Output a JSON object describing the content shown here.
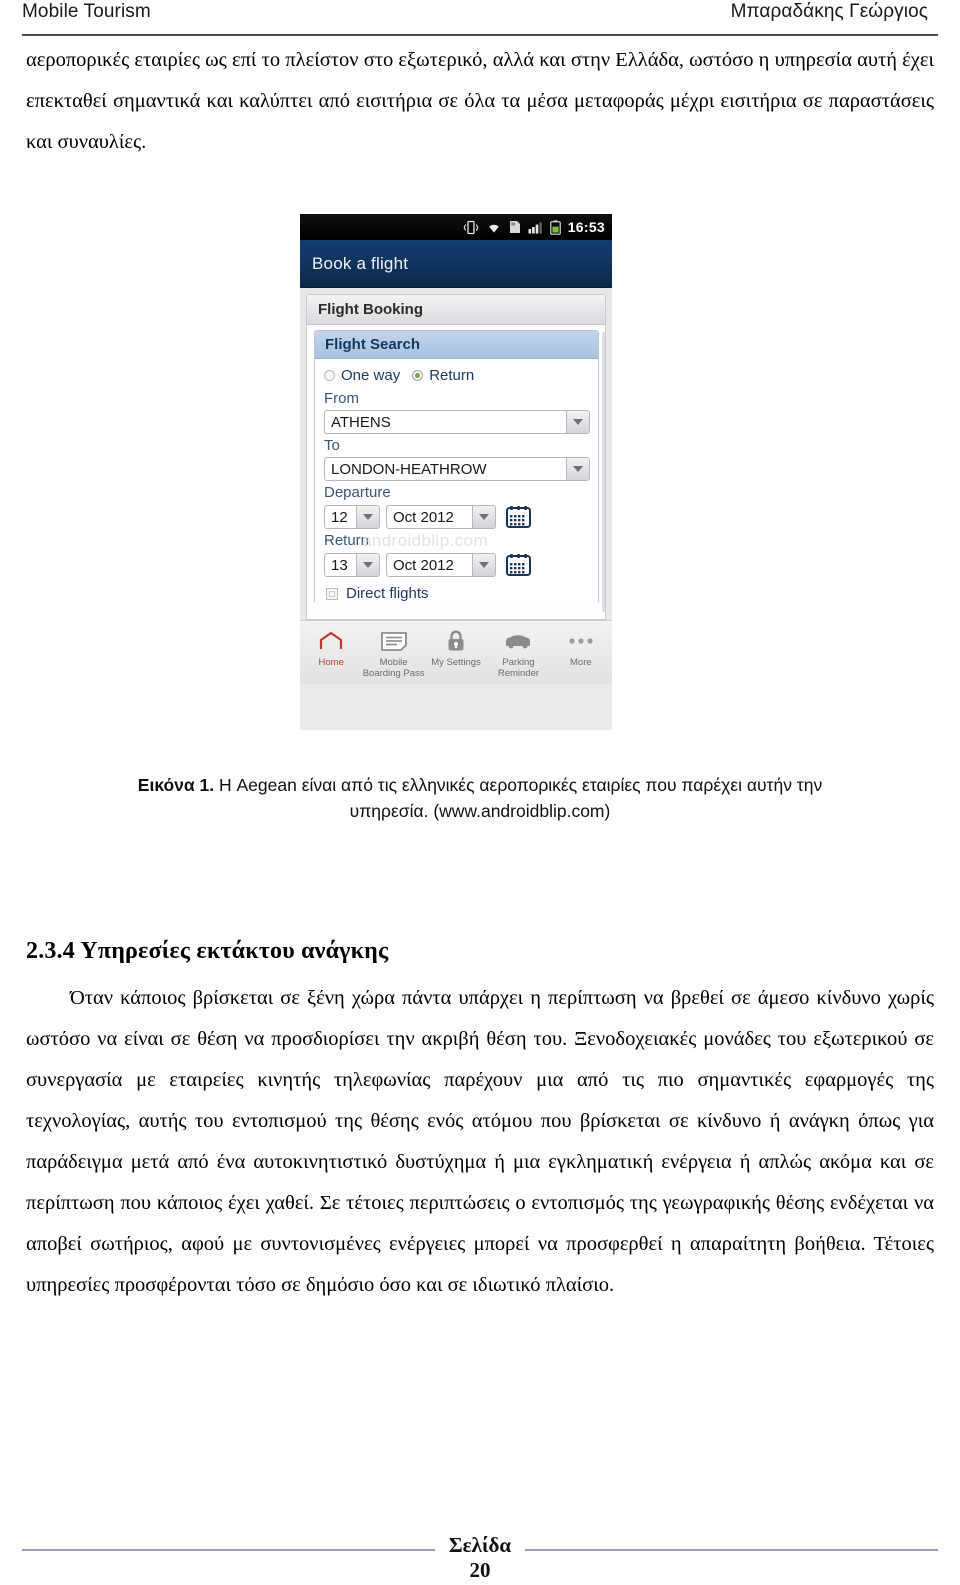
{
  "header": {
    "left": "Mobile Tourism",
    "right": "Μπαραδάκης Γεώργιος"
  },
  "body_top": {
    "paragraph": "αεροπορικές εταιρίες ως επί το πλείστον στο εξωτερικό, αλλά και στην Ελλάδα, ωστόσο η υπηρεσία αυτή έχει επεκταθεί σημαντικά και καλύπτει από εισιτήρια σε όλα τα μέσα μεταφοράς μέχρι εισιτήρια σε παραστάσεις και συναυλίες."
  },
  "figure": {
    "status_bar": {
      "time": "16:53",
      "icons": [
        "vibrate-icon",
        "wifi-icon",
        "sd-card-icon",
        "signal-icon",
        "battery-icon"
      ]
    },
    "app_title": "Book a flight",
    "panel_title": "Flight Booking",
    "subpanel_title": "Flight Search",
    "trip_type": {
      "one_way_label": "One way",
      "return_label": "Return",
      "selected": "Return"
    },
    "from": {
      "label": "From",
      "value": "ATHENS"
    },
    "to": {
      "label": "To",
      "value": "LONDON-HEATHROW"
    },
    "departure": {
      "label": "Departure",
      "day": "12",
      "month": "Oct 2012"
    },
    "return_date": {
      "label": "Return",
      "day": "13",
      "month": "Oct 2012"
    },
    "direct_flights": {
      "label": "Direct flights",
      "checked": true
    },
    "watermark": "androidblip.com",
    "tabs": [
      {
        "label": "Home",
        "icon": "home-icon",
        "active": true
      },
      {
        "label": "Mobile\nBoarding Pass",
        "line1": "Mobile",
        "line2": "Boarding Pass",
        "icon": "boarding-pass-icon",
        "active": false
      },
      {
        "label": "My Settings",
        "line1": "",
        "line2": "My Settings",
        "icon": "lock-icon",
        "active": false
      },
      {
        "label": "Parking\nReminder",
        "line1": "Parking",
        "line2": "Reminder",
        "icon": "car-icon",
        "active": false
      },
      {
        "label": "More",
        "line1": "",
        "line2": "More",
        "icon": "ellipsis-icon",
        "active": false
      }
    ],
    "colors": {
      "title_bar": "#10325a",
      "subpanel_header": "#a8c2e0",
      "active_tab": "#c0392b",
      "radio_selected": "#7ca62f"
    }
  },
  "caption": {
    "label": "Εικόνα 1.",
    "text": " Η Aegean είναι από τις ελληνικές αεροπορικές εταιρίες που παρέχει αυτήν την υπηρεσία. (www.androidblip.com)"
  },
  "section": {
    "heading": "2.3.4 Υπηρεσίες εκτάκτου ανάγκης",
    "paragraph1": "Όταν κάποιος βρίσκεται σε ξένη χώρα πάντα υπάρχει η περίπτωση να βρεθεί σε άμεσο κίνδυνο χωρίς ωστόσο να είναι σε θέση να προσδιορίσει την ακριβή θέση του. Ξενοδοχειακές μονάδες του εξωτερικού σε συνεργασία με εταιρείες κινητής τηλεφωνίας παρέχουν μια από τις πιο σημαντικές εφαρμογές της τεχνολογίας, αυτής του εντοπισμού της θέσης ενός ατόμου που βρίσκεται σε κίνδυνο ή ανάγκη όπως για παράδειγμα μετά από ένα αυτοκινητιστικό δυστύχημα ή μια εγκληματική ενέργεια ή απλώς ακόμα και σε περίπτωση που κάποιος έχει χαθεί. Σε τέτοιες περιπτώσεις ο εντοπισμός της γεωγραφικής θέσης ενδέχεται να αποβεί σωτήριος, αφού με συντονισμένες ενέργειες μπορεί να προσφερθεί η απαραίτητη βοήθεια. Τέτοιες υπηρεσίες προσφέρονται τόσο σε δημόσιο όσο και σε ιδιωτικό πλαίσιο."
  },
  "footer": {
    "page_word": "Σελίδα",
    "page_number": "20"
  }
}
